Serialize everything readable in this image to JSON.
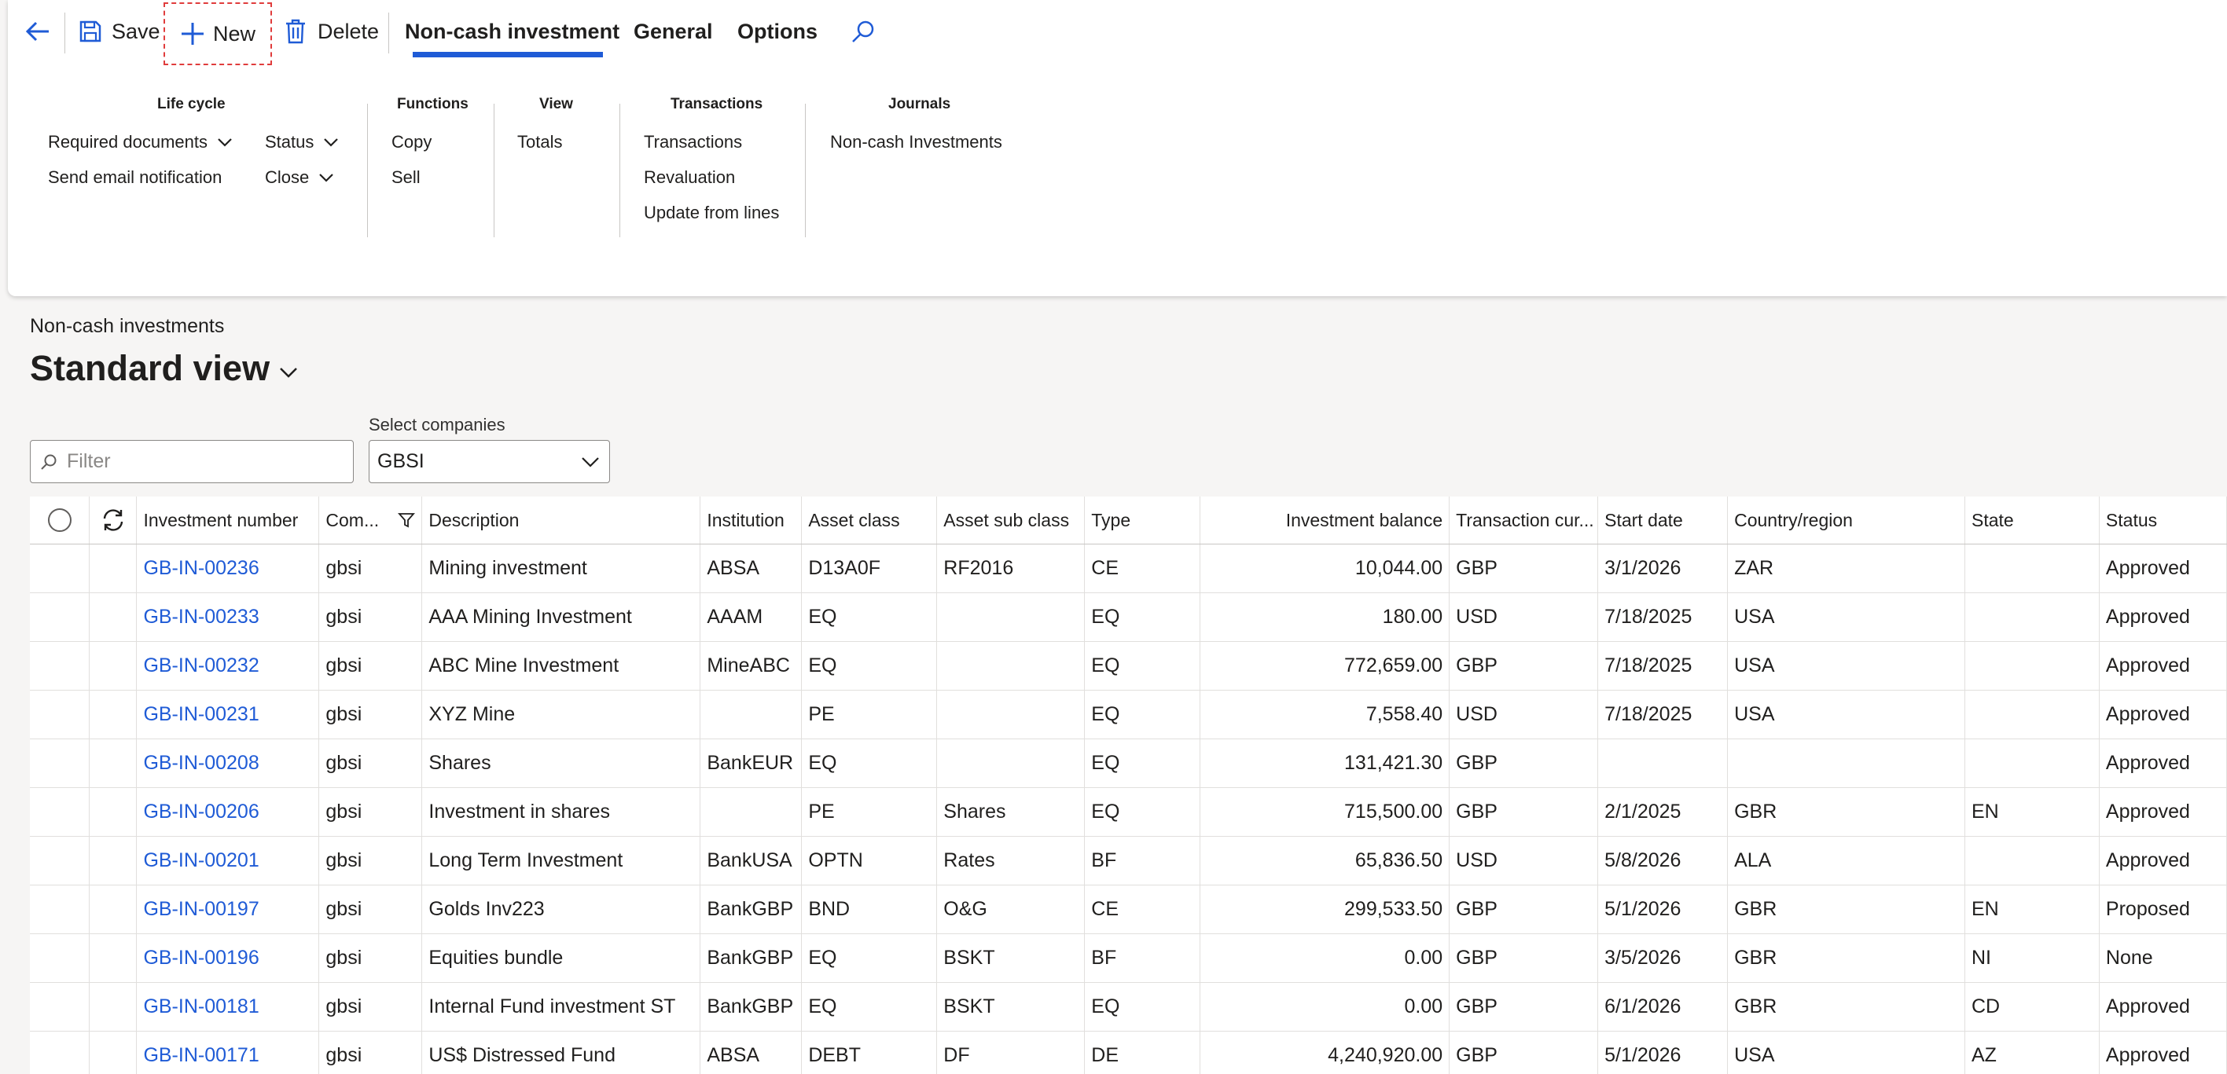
{
  "toolbar": {
    "save_label": "Save",
    "new_label": "New",
    "delete_label": "Delete",
    "tabs": [
      {
        "label": "Non-cash investment",
        "active": true
      },
      {
        "label": "General",
        "active": false
      },
      {
        "label": "Options",
        "active": false
      }
    ],
    "icons": [
      "back-arrow-icon",
      "save-icon",
      "plus-icon",
      "trash-icon",
      "search-icon"
    ],
    "accent_color": "#1f5bd6",
    "highlight_color": "#e03c3c"
  },
  "groups": {
    "lifecycle": {
      "title": "Life cycle",
      "required_documents": "Required documents",
      "send_email": "Send email notification",
      "status": "Status",
      "close": "Close"
    },
    "functions": {
      "title": "Functions",
      "copy": "Copy",
      "sell": "Sell"
    },
    "view": {
      "title": "View",
      "totals": "Totals"
    },
    "transactions": {
      "title": "Transactions",
      "transactions": "Transactions",
      "revaluation": "Revaluation",
      "update_from_lines": "Update from lines"
    },
    "journals": {
      "title": "Journals",
      "noncash": "Non-cash Investments"
    }
  },
  "page": {
    "caption": "Non-cash investments",
    "view_name": "Standard view"
  },
  "filter": {
    "placeholder": "Filter",
    "companies_label": "Select companies",
    "companies_value": "GBSI"
  },
  "grid": {
    "columns": [
      "Investment number",
      "Com...",
      "Description",
      "Institution",
      "Asset class",
      "Asset sub class",
      "Type",
      "Investment balance",
      "Transaction cur...",
      "Start date",
      "Country/region",
      "State",
      "Status"
    ],
    "rows": [
      {
        "number": "GB-IN-00236",
        "company": "gbsi",
        "description": "Mining investment",
        "institution": "ABSA",
        "asset_class": "D13A0F",
        "asset_sub_class": "RF2016",
        "type": "CE",
        "balance": "10,044.00",
        "currency": "GBP",
        "start_date": "3/1/2026",
        "country": "ZAR",
        "state": "",
        "status": "Approved"
      },
      {
        "number": "GB-IN-00233",
        "company": "gbsi",
        "description": "AAA Mining Investment",
        "institution": "AAAM",
        "asset_class": "EQ",
        "asset_sub_class": "",
        "type": "EQ",
        "balance": "180.00",
        "currency": "USD",
        "start_date": "7/18/2025",
        "country": "USA",
        "state": "",
        "status": "Approved"
      },
      {
        "number": "GB-IN-00232",
        "company": "gbsi",
        "description": "ABC Mine Investment",
        "institution": "MineABC",
        "asset_class": "EQ",
        "asset_sub_class": "",
        "type": "EQ",
        "balance": "772,659.00",
        "currency": "GBP",
        "start_date": "7/18/2025",
        "country": "USA",
        "state": "",
        "status": "Approved"
      },
      {
        "number": "GB-IN-00231",
        "company": "gbsi",
        "description": "XYZ Mine",
        "institution": "",
        "asset_class": "PE",
        "asset_sub_class": "",
        "type": "EQ",
        "balance": "7,558.40",
        "currency": "USD",
        "start_date": "7/18/2025",
        "country": "USA",
        "state": "",
        "status": "Approved"
      },
      {
        "number": "GB-IN-00208",
        "company": "gbsi",
        "description": "Shares",
        "institution": "BankEUR",
        "asset_class": "EQ",
        "asset_sub_class": "",
        "type": "EQ",
        "balance": "131,421.30",
        "currency": "GBP",
        "start_date": "",
        "country": "",
        "state": "",
        "status": "Approved"
      },
      {
        "number": "GB-IN-00206",
        "company": "gbsi",
        "description": "Investment in shares",
        "institution": "",
        "asset_class": "PE",
        "asset_sub_class": "Shares",
        "type": "EQ",
        "balance": "715,500.00",
        "currency": "GBP",
        "start_date": "2/1/2025",
        "country": "GBR",
        "state": "EN",
        "status": "Approved"
      },
      {
        "number": "GB-IN-00201",
        "company": "gbsi",
        "description": "Long Term Investment",
        "institution": "BankUSA",
        "asset_class": "OPTN",
        "asset_sub_class": "Rates",
        "type": "BF",
        "balance": "65,836.50",
        "currency": "USD",
        "start_date": "5/8/2026",
        "country": "ALA",
        "state": "",
        "status": "Approved"
      },
      {
        "number": "GB-IN-00197",
        "company": "gbsi",
        "description": "Golds Inv223",
        "institution": "BankGBP",
        "asset_class": "BND",
        "asset_sub_class": "O&G",
        "type": "CE",
        "balance": "299,533.50",
        "currency": "GBP",
        "start_date": "5/1/2026",
        "country": "GBR",
        "state": "EN",
        "status": "Proposed"
      },
      {
        "number": "GB-IN-00196",
        "company": "gbsi",
        "description": "Equities bundle",
        "institution": "BankGBP",
        "asset_class": "EQ",
        "asset_sub_class": "BSKT",
        "type": "BF",
        "balance": "0.00",
        "currency": "GBP",
        "start_date": "3/5/2026",
        "country": "GBR",
        "state": "NI",
        "status": "None"
      },
      {
        "number": "GB-IN-00181",
        "company": "gbsi",
        "description": "Internal Fund investment ST",
        "institution": "BankGBP",
        "asset_class": "EQ",
        "asset_sub_class": "BSKT",
        "type": "EQ",
        "balance": "0.00",
        "currency": "GBP",
        "start_date": "6/1/2026",
        "country": "GBR",
        "state": "CD",
        "status": "Approved"
      },
      {
        "number": "GB-IN-00171",
        "company": "gbsi",
        "description": "US$ Distressed Fund",
        "institution": "ABSA",
        "asset_class": "DEBT",
        "asset_sub_class": "DF",
        "type": "DE",
        "balance": "4,240,920.00",
        "currency": "GBP",
        "start_date": "5/1/2026",
        "country": "USA",
        "state": "AZ",
        "status": "Approved"
      }
    ]
  }
}
